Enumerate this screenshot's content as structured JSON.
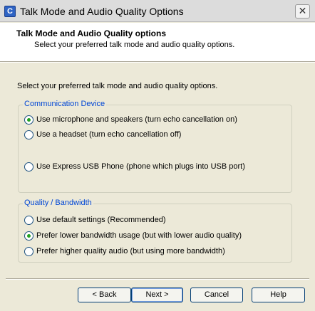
{
  "window": {
    "title": "Talk Mode and Audio Quality Options",
    "icon": "app-logo-icon",
    "icon_glyph": "C",
    "close_glyph": "✕"
  },
  "header": {
    "title": "Talk Mode and Audio Quality options",
    "subtitle": "Select your preferred talk mode and audio quality options."
  },
  "intro": "Select your preferred talk mode and audio quality options.",
  "communication_device": {
    "legend": "Communication Device",
    "options": [
      {
        "label": "Use microphone and speakers (turn echo cancellation on)",
        "checked": true
      },
      {
        "label": "Use a headset (turn echo cancellation off)",
        "checked": false
      },
      {
        "label": "Use Express USB Phone (phone which plugs into USB port)",
        "checked": false
      }
    ]
  },
  "quality_bandwidth": {
    "legend": "Quality / Bandwidth",
    "options": [
      {
        "label": "Use default settings (Recommended)",
        "checked": false
      },
      {
        "label": "Prefer lower bandwidth usage (but with lower audio quality)",
        "checked": true
      },
      {
        "label": "Prefer higher quality audio (but using more bandwidth)",
        "checked": false
      }
    ]
  },
  "buttons": {
    "back": "< Back",
    "next": "Next >",
    "cancel": "Cancel",
    "help": "Help"
  },
  "colors": {
    "accent": "#0046d5",
    "radio_checked": "#21a121"
  }
}
